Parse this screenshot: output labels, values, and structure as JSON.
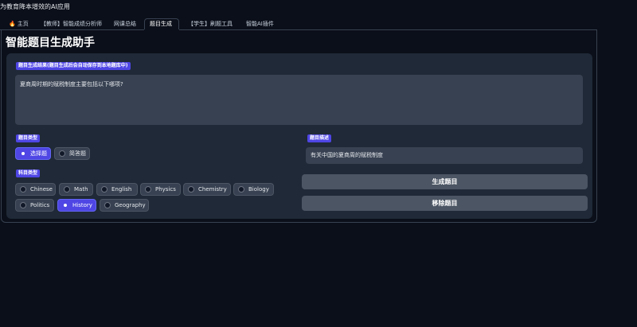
{
  "app": {
    "title": "为教育降本增效的AI应用"
  },
  "tabs": [
    {
      "label": "主页"
    },
    {
      "label": "【教师】智能成绩分析师"
    },
    {
      "label": "网课总结"
    },
    {
      "label": "题目生成"
    },
    {
      "label": "【学生】刷题工具"
    },
    {
      "label": "智能AI插件"
    }
  ],
  "page": {
    "title": "智能题目生成助手",
    "result_label": "题目生成结果(题目生成后会自动保存到本地题库中)",
    "result_text": "夏商周时期的赋税制度主要包括以下哪项?",
    "question_type_label": "题目类型",
    "question_types": [
      "选择题",
      "简答题"
    ],
    "question_type_selected": "选择题",
    "subject_label": "科目类型",
    "subjects": [
      "Chinese",
      "Math",
      "English",
      "Physics",
      "Chemistry",
      "Biology",
      "Politics",
      "History",
      "Geography"
    ],
    "subject_selected": "History",
    "description_label": "题目描述",
    "description_value": "有关中国的夏商周的赋税制度",
    "generate_button": "生成题目",
    "remove_button": "移除题目"
  },
  "colors": {
    "background": "#0b0f19",
    "card": "#1f2937",
    "accent": "#4f46e5",
    "input": "#374151",
    "button": "#4b5563"
  }
}
